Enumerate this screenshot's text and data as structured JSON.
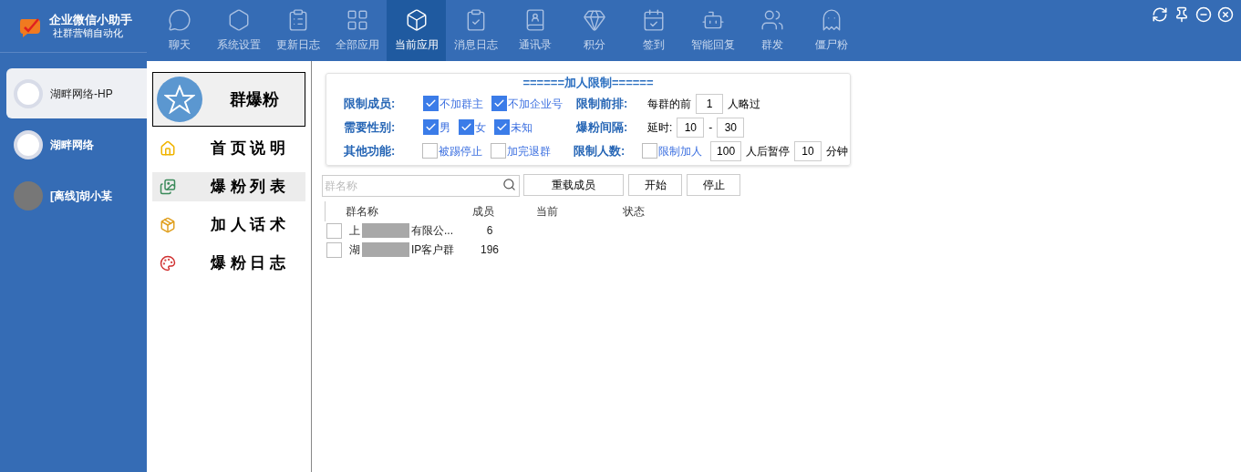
{
  "app": {
    "title": "企业微信小助手",
    "subtitle": "社群营销自动化"
  },
  "tabs": [
    {
      "label": "聊天",
      "selected": false
    },
    {
      "label": "系统设置",
      "selected": false
    },
    {
      "label": "更新日志",
      "selected": false
    },
    {
      "label": "全部应用",
      "selected": false
    },
    {
      "label": "当前应用",
      "selected": true
    },
    {
      "label": "消息日志",
      "selected": false
    },
    {
      "label": "通讯录",
      "selected": false
    },
    {
      "label": "积分",
      "selected": false
    },
    {
      "label": "签到",
      "selected": false
    },
    {
      "label": "智能回复",
      "selected": false
    },
    {
      "label": "群发",
      "selected": false
    },
    {
      "label": "僵尸粉",
      "selected": false
    }
  ],
  "accounts": [
    {
      "name": "湖畔网络-HP",
      "selected": true
    },
    {
      "name": "湖畔网络",
      "selected": false
    },
    {
      "name": "[离线]胡小某",
      "selected": false
    }
  ],
  "menu": {
    "title": "群爆粉",
    "items": [
      {
        "label": "首 页 说 明",
        "selected": false
      },
      {
        "label": "爆 粉 列 表",
        "selected": true
      },
      {
        "label": "加 人 话 术",
        "selected": false
      },
      {
        "label": "爆 粉 日 志",
        "selected": false
      }
    ]
  },
  "settings": {
    "heading": "======加人限制======",
    "rows": [
      {
        "items": [
          {
            "kind": "label",
            "text": "限制成员:"
          },
          {
            "kind": "checkbox",
            "label": "不加群主",
            "checked": true
          },
          {
            "kind": "checkbox",
            "label": "不加企业号",
            "checked": true
          },
          {
            "kind": "label",
            "text": "限制前排:"
          },
          {
            "kind": "text",
            "text": "每群的前"
          },
          {
            "kind": "input",
            "value": "1"
          },
          {
            "kind": "text",
            "text": "人略过"
          }
        ]
      },
      {
        "items": [
          {
            "kind": "label",
            "text": "需要性别:"
          },
          {
            "kind": "checkbox",
            "label": "男",
            "checked": true
          },
          {
            "kind": "checkbox",
            "label": "女",
            "checked": true
          },
          {
            "kind": "checkbox",
            "label": "未知",
            "checked": true
          },
          {
            "kind": "label",
            "text": "爆粉间隔:"
          },
          {
            "kind": "text",
            "text": "延时:"
          },
          {
            "kind": "input",
            "value": "10"
          },
          {
            "kind": "text",
            "text": "-"
          },
          {
            "kind": "input",
            "value": "30"
          }
        ]
      },
      {
        "items": [
          {
            "kind": "label",
            "text": "其他功能:"
          },
          {
            "kind": "checkbox",
            "label": "被踢停止",
            "checked": false
          },
          {
            "kind": "checkbox",
            "label": "加完退群",
            "checked": false
          },
          {
            "kind": "label",
            "text": "限制人数:"
          },
          {
            "kind": "checkbox",
            "label": "限制加人",
            "checked": false
          },
          {
            "kind": "input",
            "value": "100"
          },
          {
            "kind": "text",
            "text": "人后暂停"
          },
          {
            "kind": "input",
            "value": "10"
          },
          {
            "kind": "text",
            "text": "分钟"
          }
        ]
      }
    ]
  },
  "search": {
    "placeholder": "群名称"
  },
  "buttons": [
    "重载成员",
    "开始",
    "停止"
  ],
  "table": {
    "columns": [
      "群名称",
      "成员",
      "当前",
      "状态"
    ],
    "rows": [
      {
        "checked": false,
        "name_prefix": "上",
        "name_suffix": "有限公...",
        "members": "6"
      },
      {
        "checked": false,
        "name_prefix": "湖",
        "name_suffix": "IP客户群",
        "members": "196"
      }
    ]
  }
}
